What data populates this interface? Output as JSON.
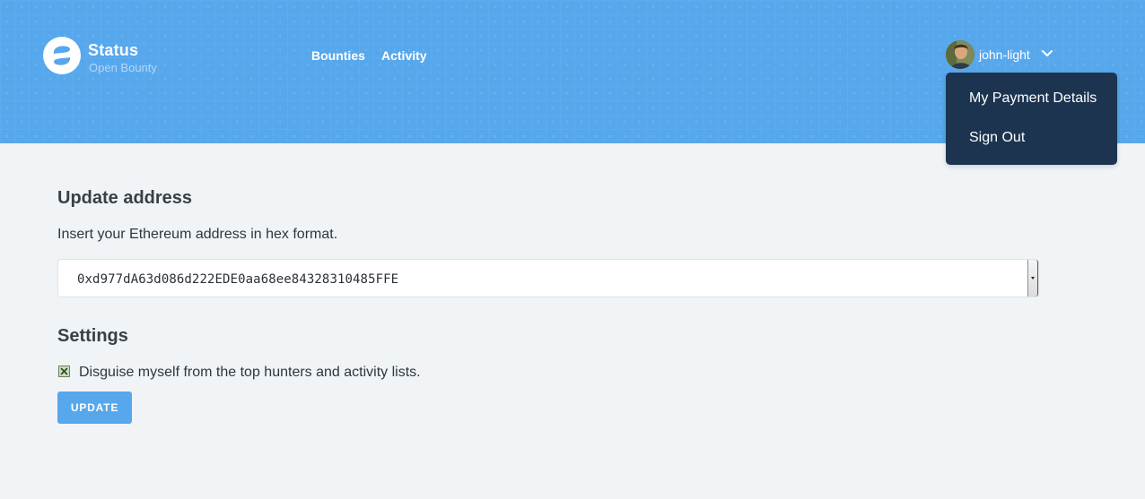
{
  "header": {
    "brand_title": "Status",
    "brand_subtitle": "Open Bounty",
    "nav": {
      "bounties": "Bounties",
      "activity": "Activity"
    },
    "user": {
      "username": "john-light"
    },
    "dropdown": {
      "payment_details": "My Payment Details",
      "sign_out": "Sign Out"
    },
    "icons": {
      "logo": "status-logo-icon",
      "avatar": "user-avatar",
      "chevron": "chevron-down-icon"
    }
  },
  "main": {
    "update_address": {
      "title": "Update address",
      "instruction": "Insert your Ethereum address in hex format.",
      "address_value": "0xd977dA63d086d222EDE0aa68ee84328310485FFE"
    },
    "settings": {
      "title": "Settings",
      "disguise_label": "Disguise myself from the top hunters and activity lists.",
      "disguise_checked": true
    },
    "update_button": "UPDATE"
  },
  "colors": {
    "header_bg": "#57a7ed",
    "dropdown_bg": "#1c3450",
    "page_bg": "#f0f4f6",
    "button_bg": "#57a7ed"
  }
}
